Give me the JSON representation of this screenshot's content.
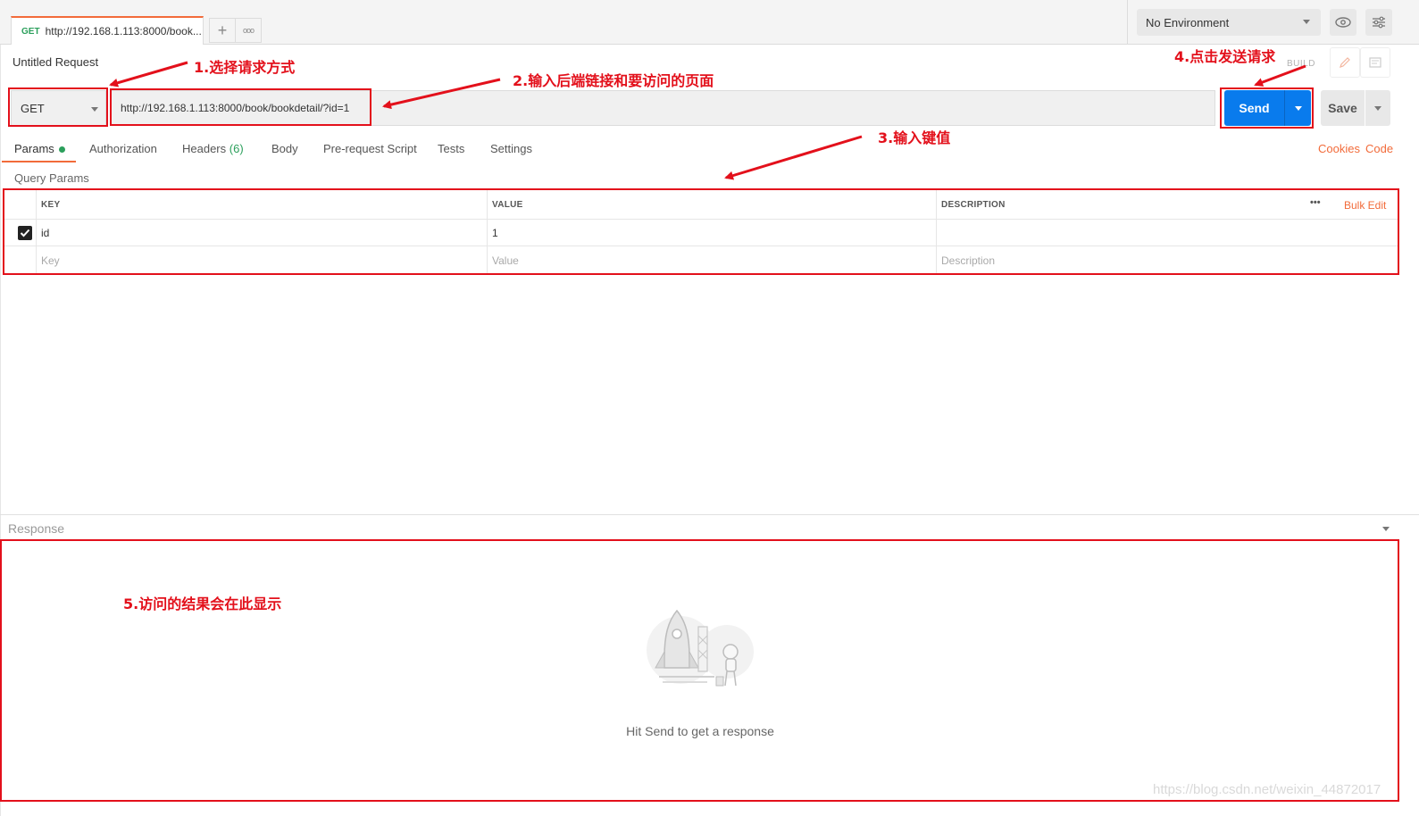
{
  "tab": {
    "method": "GET",
    "url": "http://192.168.1.113:8000/book...",
    "new_tab_label": "+",
    "more_label": "ooo"
  },
  "environment": {
    "selected": "No Environment"
  },
  "request": {
    "title": "Untitled Request",
    "build_label": "BUILD",
    "method": "GET",
    "url": "http://192.168.1.113:8000/book/bookdetail/?id=1",
    "send_label": "Send",
    "save_label": "Save"
  },
  "subtabs": {
    "params": "Params",
    "authorization": "Authorization",
    "headers": "Headers",
    "headers_count": "(6)",
    "body": "Body",
    "prerequest": "Pre-request Script",
    "tests": "Tests",
    "settings": "Settings",
    "cookies": "Cookies",
    "code": "Code"
  },
  "query_params": {
    "label": "Query Params",
    "columns": [
      "KEY",
      "VALUE",
      "DESCRIPTION"
    ],
    "bulk_edit": "Bulk Edit",
    "more": "•••",
    "rows": [
      {
        "key": "id",
        "value": "1",
        "description": "",
        "checked": true
      }
    ],
    "placeholders": {
      "key": "Key",
      "value": "Value",
      "description": "Description"
    }
  },
  "response": {
    "label": "Response",
    "hint": "Hit Send to get a response"
  },
  "annotations": {
    "a1": "1.选择请求方式",
    "a2": "2.输入后端链接和要访问的页面",
    "a3": "3.输入键值",
    "a4": "4.点击发送请求",
    "a5": "5.访问的结果会在此显示"
  },
  "watermark": "https://blog.csdn.net/weixin_44872017",
  "colors": {
    "accent": "#f26b3a",
    "send": "#097bed",
    "annotation": "#e3101b",
    "status_green": "#2b9f5b"
  }
}
